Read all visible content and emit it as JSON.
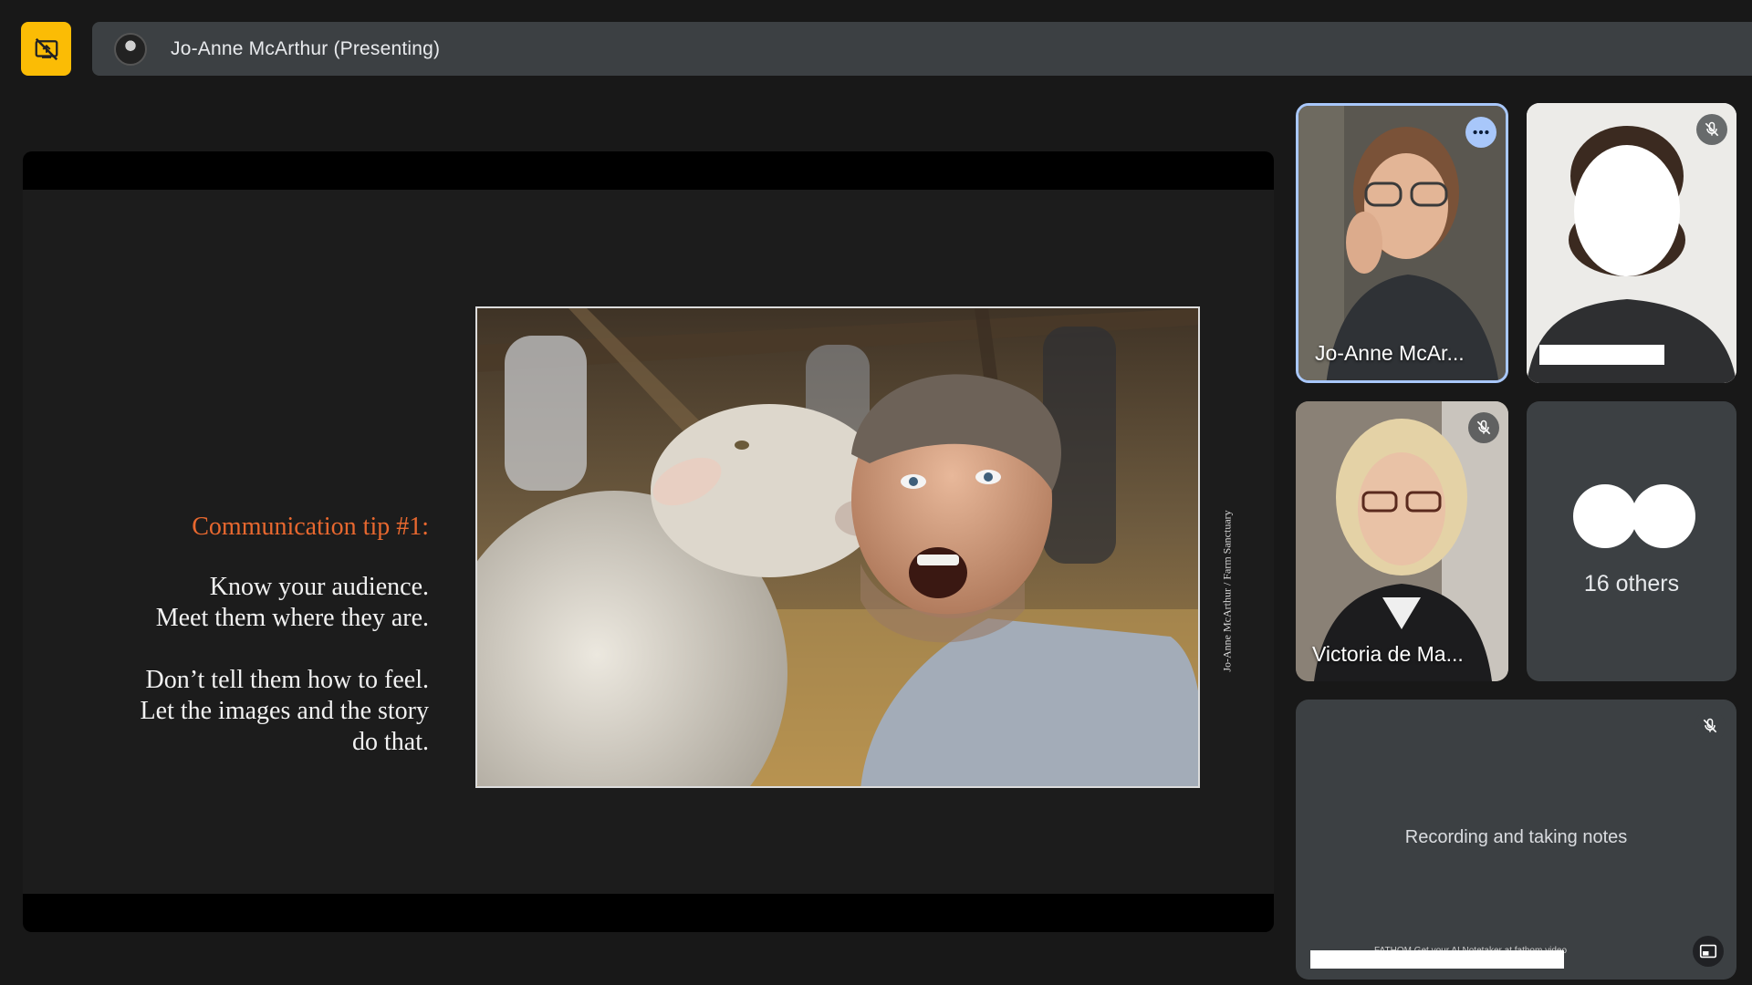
{
  "presenter": {
    "name": "Jo-Anne McArthur (Presenting)"
  },
  "slide": {
    "tip_title": "Communication tip #1:",
    "lines": [
      "Know your audience.",
      "Meet them where they are.",
      "Don’t tell them how to feel.",
      "Let the images and the story",
      "do that."
    ],
    "photo_credit": "Jo-Anne McArthur / Farm Sanctuary"
  },
  "participants": [
    {
      "label": "Jo-Anne McAr...",
      "muted": false,
      "active_speaker": true
    },
    {
      "label": "",
      "muted": true,
      "active_speaker": false
    },
    {
      "label": "Victoria de Ma...",
      "muted": true,
      "active_speaker": false
    }
  ],
  "others": {
    "label": "16 others"
  },
  "fathom": {
    "status": "Recording and taking notes",
    "footer": "FATHOM  Get your AI Notetaker at fathom.video"
  },
  "colors": {
    "accent_yellow": "#fbbc05",
    "active_speaker_border": "#a8c7fa",
    "tip_title": "#e8682f",
    "tile_bg": "#3c4043"
  },
  "icons": {
    "present_toggle": "present-to-all-off-icon",
    "mic_off": "mic-off-icon",
    "more": "more-horiz-icon",
    "pip": "picture-in-picture-icon"
  }
}
